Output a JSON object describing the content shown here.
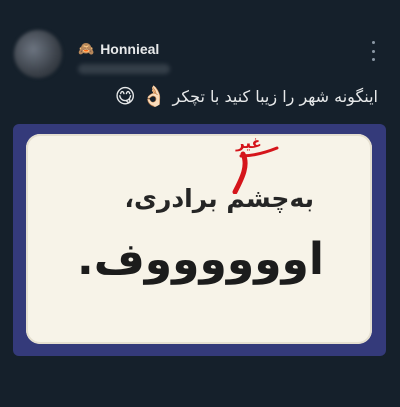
{
  "author": {
    "name": "Honnieal",
    "emoji": "🙈"
  },
  "post": {
    "text": "اینگونه شهر را زیبا کنید با تچکر",
    "emojis": [
      "👌🏻",
      "😋"
    ]
  },
  "media": {
    "sign_line1": "به‌چشم برادری،",
    "sign_line2": "اووووووف.",
    "annotation_word": "غیر"
  },
  "colors": {
    "background": "#15202b",
    "media_frame": "#343a7a",
    "sign": "#f7f3e8",
    "annotation": "#d5151b"
  },
  "icons": [
    "more-vertical-icon"
  ]
}
